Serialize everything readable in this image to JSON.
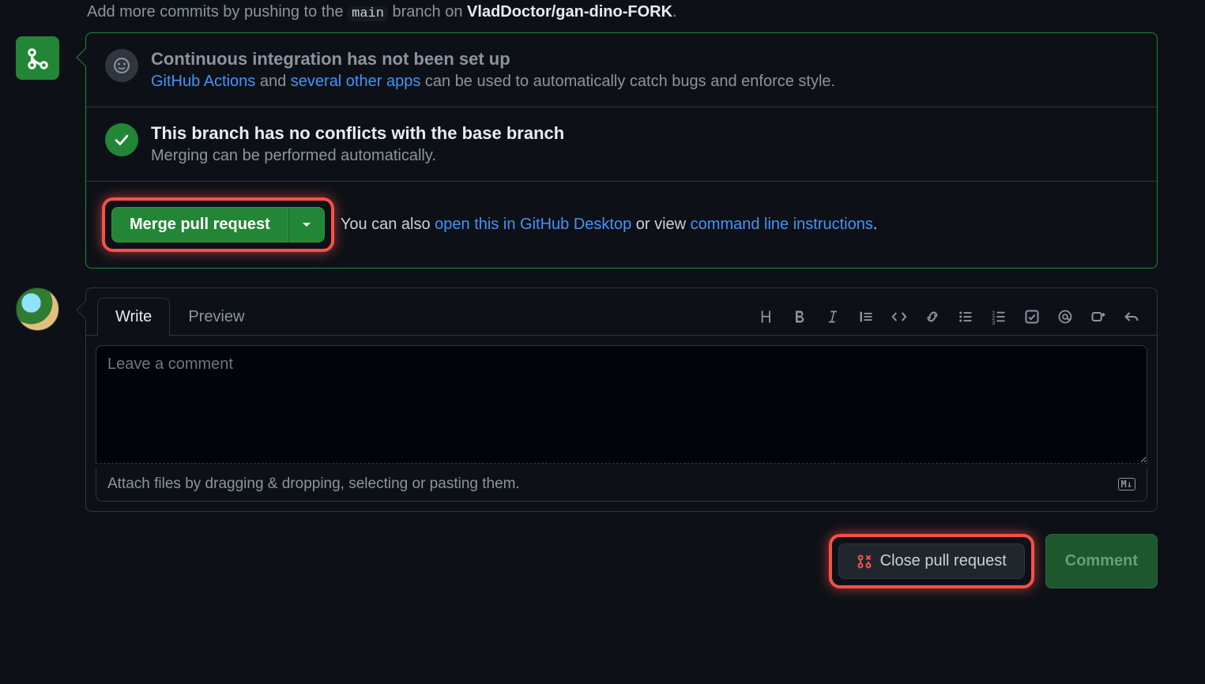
{
  "hint": {
    "prefix": "Add more commits by pushing to the ",
    "branch": "main",
    "middle": " branch on ",
    "repo": "VladDoctor/gan-dino-FORK",
    "suffix": "."
  },
  "ci": {
    "title": "Continuous integration has not been set up",
    "link_actions": "GitHub Actions",
    "mid1": " and ",
    "link_apps": "several other apps",
    "tail": " can be used to automatically catch bugs and enforce style."
  },
  "conflict": {
    "title": "This branch has no conflicts with the base branch",
    "subtitle": "Merging can be performed automatically."
  },
  "merge": {
    "button": "Merge pull request",
    "hint_prefix": "You can also ",
    "link_desktop": "open this in GitHub Desktop",
    "hint_mid": " or view ",
    "link_cli": "command line instructions",
    "hint_suffix": "."
  },
  "comment": {
    "tab_write": "Write",
    "tab_preview": "Preview",
    "placeholder": "Leave a comment",
    "attach": "Attach files by dragging & dropping, selecting or pasting them.",
    "markdown_badge": "M↓"
  },
  "actions": {
    "close": "Close pull request",
    "comment": "Comment"
  }
}
